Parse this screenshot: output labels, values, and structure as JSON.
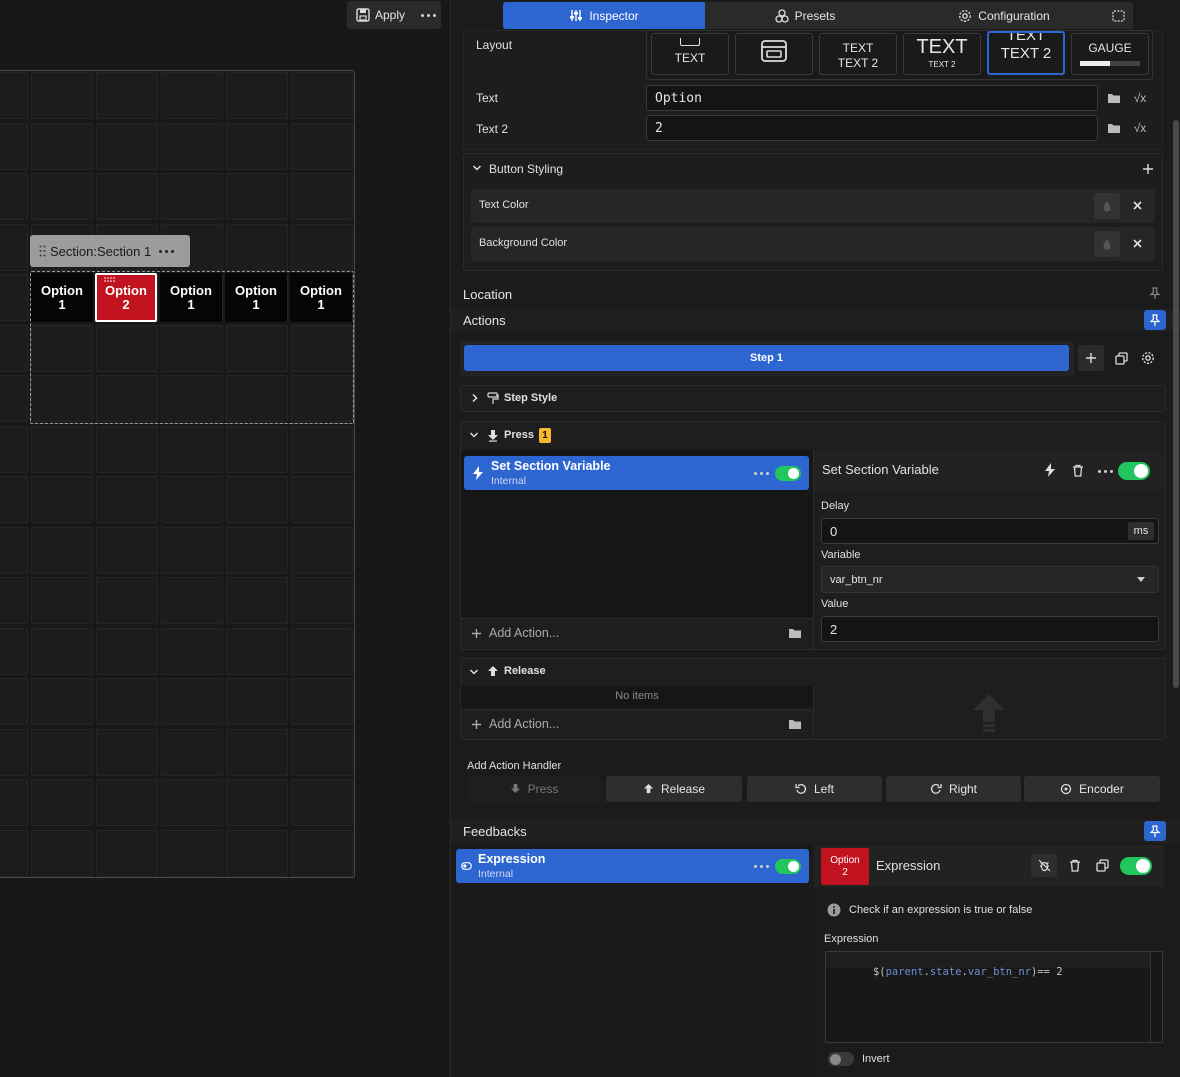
{
  "canvas": {
    "apply_label": "Apply",
    "section_label": "Section:Section 1",
    "buttons": [
      {
        "line1": "Option",
        "line2": "1"
      },
      {
        "line1": "Option",
        "line2": "2"
      },
      {
        "line1": "Option",
        "line2": "1"
      },
      {
        "line1": "Option",
        "line2": "1"
      },
      {
        "line1": "Option",
        "line2": "1"
      }
    ]
  },
  "tabs": [
    "Inspector",
    "Presets",
    "Configuration"
  ],
  "layout": {
    "label": "Layout",
    "options": [
      {
        "top": "",
        "main": "TEXT"
      },
      {
        "top": "",
        "main": ""
      },
      {
        "top": "TEXT",
        "main": "TEXT 2"
      },
      {
        "top": "TEXT",
        "main": "TEXT 2"
      },
      {
        "top": "TEXT",
        "main": "TEXT 2"
      },
      {
        "top": "GAUGE",
        "main": ""
      }
    ]
  },
  "fields": {
    "text_label": "Text",
    "text_value": "Option",
    "text2_label": "Text 2",
    "text2_value": "2"
  },
  "button_styling": {
    "title": "Button Styling",
    "text_color": "Text Color",
    "background_color": "Background Color"
  },
  "location_label": "Location",
  "actions": {
    "label": "Actions",
    "step": "Step 1",
    "step_style": "Step Style",
    "press": "Press",
    "press_count": "1",
    "item_title": "Set Section Variable",
    "item_sub": "Internal",
    "add_action": "Add Action...",
    "detail": {
      "title": "Set Section Variable",
      "delay_label": "Delay",
      "delay_value": "0",
      "delay_unit": "ms",
      "variable_label": "Variable",
      "variable_value": "var_btn_nr",
      "value_label": "Value",
      "value_value": "2"
    },
    "release": "Release",
    "no_items": "No items",
    "add_handler_label": "Add Action Handler",
    "handlers": [
      "Press",
      "Release",
      "Left",
      "Right",
      "Encoder"
    ]
  },
  "feedbacks": {
    "label": "Feedbacks",
    "item_title": "Expression",
    "item_sub": "Internal",
    "preview_line1": "Option",
    "preview_line2": "2",
    "detail_title": "Expression",
    "info": "Check if an expression is true or false",
    "expression_label": "Expression",
    "expression_tokens": [
      "$(",
      "parent",
      ".",
      "state",
      ".",
      "var_btn_nr",
      ")== 2"
    ],
    "invert_label": "Invert"
  },
  "colors": {
    "accent": "#2d66d1",
    "selected_button": "#c1121f",
    "toggle_on": "#22c55e",
    "badge": "#f5b82e"
  }
}
